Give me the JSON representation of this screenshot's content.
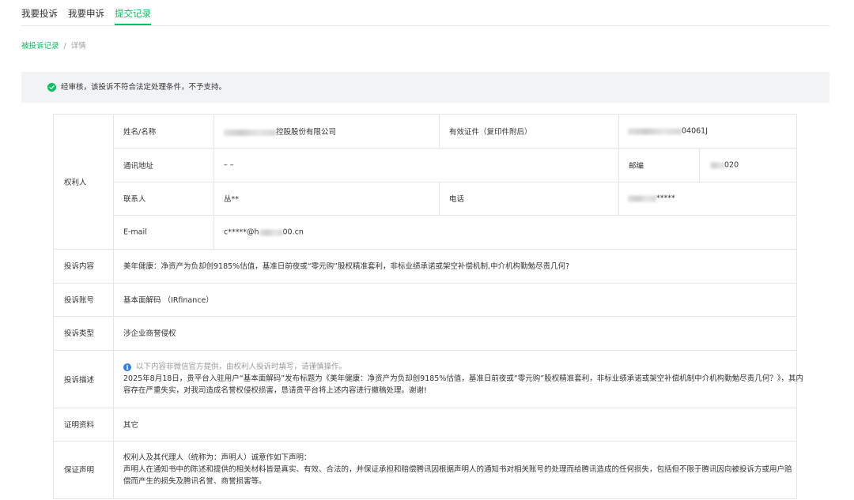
{
  "tabs": [
    {
      "label": "我要投诉",
      "active": false
    },
    {
      "label": "我要申诉",
      "active": false
    },
    {
      "label": "提交记录",
      "active": true
    }
  ],
  "breadcrumb": {
    "link": "被投诉记录",
    "separator": "/",
    "current": "详情"
  },
  "notice": {
    "icon": "check-circle-icon",
    "text": "经审核，该投诉不符合法定处理条件，不予支持。"
  },
  "right_holder": {
    "section_label": "权利人",
    "name_label": "姓名/名称",
    "name_value": "控股股份有限公司",
    "cert_label": "有效证件（复印件附后）",
    "cert_value": "04061J",
    "address_label": "通讯地址",
    "address_value": "– –",
    "zip_label": "邮编",
    "zip_value": "020",
    "contact_label": "联系人",
    "contact_value": "丛**",
    "phone_label": "电话",
    "phone_value": "*****",
    "email_label": "E-mail",
    "email_value_prefix": "c*****@h",
    "email_value_suffix": "00.cn"
  },
  "complaint_content": {
    "label": "投诉内容",
    "value": "美年健康：净资产为负却创9185%估值，基准日前夜或“零元购”股权精准套利，非标业绩承诺或架空补偿机制,中介机构勤勉尽责几何?"
  },
  "complaint_account": {
    "label": "投诉账号",
    "value": "基本面解码 （IRfinance）"
  },
  "complaint_type": {
    "label": "投诉类型",
    "value": "涉企业商誉侵权"
  },
  "complaint_desc": {
    "label": "投诉描述",
    "hint": "以下内容非微信官方提供，由权利人投诉时填写，请谨慎操作。",
    "line1": "2025年8月18日，贵平台入驻用户“基本面解码”发布标题为《美年健康：净资产为负却创9185%估值，基准日前夜或“零元购”股权精准套利，非标业绩承诺或架空补偿机制中介机构勤勉尽责几何？》，其内",
    "line2": "容存在严重失实，对我司造成名誉权侵权损害，恳请贵平台将上述内容进行撤稿处理。谢谢!"
  },
  "evidence": {
    "label": "证明资料",
    "value": "其它"
  },
  "guarantee": {
    "label": "保证声明",
    "line1": "权利人及其代理人（统称为：声明人）诚意作如下声明：",
    "line2": "声明人在通知书中的陈述和提供的相关材料皆是真实、有效、合法的，并保证承担和赔偿腾讯因根据声明人的通知书对相关账号的处理而给腾讯造成的任何损失，包括但不限于腾讯因向被投诉方或用户赔",
    "line3": "偿而产生的损失及腾讯名誉、商誉损害等。"
  },
  "colors": {
    "accent": "#07c160",
    "border": "#e5e5e5",
    "notice_bg": "#f2f3f5",
    "info": "#2f7fe8"
  }
}
